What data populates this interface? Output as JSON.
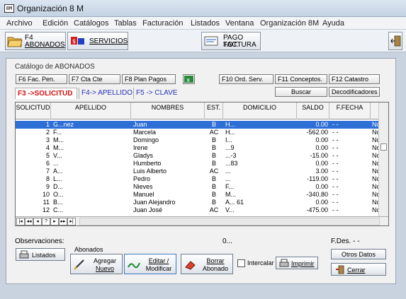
{
  "window": {
    "icon_text": "8M",
    "title": "Organización  8 M"
  },
  "menu": [
    "Archivo",
    "Edición",
    "Catálogos",
    "Tablas",
    "Facturación",
    "Listados",
    "Ventana",
    "Organización 8M",
    "Ayuda"
  ],
  "toolbar": {
    "abonados_line1": "F4",
    "abonados_line2": "ABONADOS",
    "servicios": "SERVICIOS",
    "pago_line1": "PAGO TOT.",
    "pago_line2": "FACTURA"
  },
  "catalog": {
    "title": "Catálogo de ABONADOS",
    "fkeys_left": [
      "F6   Fac. Pen.",
      "F7        Cta Cte",
      "F8  Plan  Pagos"
    ],
    "fkeys_right": [
      "F10   Ord. Serv.",
      "F11  Conceptos.",
      "F12        Catastro"
    ],
    "buscar": "Buscar",
    "decodificadores": "Decodificadores"
  },
  "tabs": [
    "F3 ->SOLICITUD",
    "F4-> APELLIDO",
    "F5 -> CLAVE"
  ],
  "grid": {
    "columns": [
      "SOLICITUD",
      "APELLIDO",
      "NOMBRES",
      "EST.",
      "DOMICILIO",
      "SALDO",
      "F.FECHA",
      ""
    ],
    "rows": [
      {
        "sol": "1",
        "ape": "G...nez",
        "nom": "Juan",
        "est": "B",
        "dom": "H...",
        "saldo": "0.00",
        "fecha": "-   -",
        "x": "No"
      },
      {
        "sol": "2",
        "ape": "F...",
        "nom": "Marcela",
        "est": "AC",
        "dom": "H...",
        "saldo": "-562.00",
        "fecha": "-   -",
        "x": "No"
      },
      {
        "sol": "3",
        "ape": "M...",
        "nom": "Domingo",
        "est": "B",
        "dom": "I...",
        "saldo": "0.00",
        "fecha": "-   -",
        "x": "No"
      },
      {
        "sol": "4",
        "ape": "M...",
        "nom": "Irene",
        "est": "B",
        "dom": "...9",
        "saldo": "0.00",
        "fecha": "-   -",
        "x": "No"
      },
      {
        "sol": "5",
        "ape": "V...",
        "nom": "Gladys",
        "est": "B",
        "dom": "...-3",
        "saldo": "-15.00",
        "fecha": "-   -",
        "x": "No"
      },
      {
        "sol": "6",
        "ape": "...",
        "nom": "Humberto",
        "est": "B",
        "dom": "...83",
        "saldo": "0.00",
        "fecha": "-   -",
        "x": "No"
      },
      {
        "sol": "7",
        "ape": "A...",
        "nom": "Luis Alberto",
        "est": "AC",
        "dom": "...",
        "saldo": "3.00",
        "fecha": "-   -",
        "x": "No"
      },
      {
        "sol": "8",
        "ape": "L...",
        "nom": "Pedro",
        "est": "B",
        "dom": "...",
        "saldo": "-119.00",
        "fecha": "-   -",
        "x": "No"
      },
      {
        "sol": "9",
        "ape": "D...",
        "nom": "Nieves",
        "est": "B",
        "dom": "F...",
        "saldo": "0.00",
        "fecha": "-   -",
        "x": "No"
      },
      {
        "sol": "10",
        "ape": "O...",
        "nom": "Manuel",
        "est": "B",
        "dom": "M...",
        "saldo": "-340.80",
        "fecha": "-   -",
        "x": "No"
      },
      {
        "sol": "11",
        "ape": "B...",
        "nom": "Juan Alejandro",
        "est": "B",
        "dom": "A... 61",
        "saldo": "0.00",
        "fecha": "-   -",
        "x": "No"
      },
      {
        "sol": "12",
        "ape": "C...",
        "nom": "Juan José",
        "est": "AC",
        "dom": "V...",
        "saldo": "-475.00",
        "fecha": "-   -",
        "x": "No"
      }
    ],
    "selected_row": 0
  },
  "nav": [
    "|◂",
    "◂◂",
    "◂",
    "?",
    "▸",
    "▸▸",
    "▸|"
  ],
  "footer": {
    "observaciones": "Observaciones:",
    "obs_value": "0...",
    "fdes": "F.Des.   -  -",
    "abonados_group": "Abonados",
    "listados": "Listados",
    "agregar_line1": "Agregar",
    "agregar_line2": "Nuevo",
    "editar_line1": "Editar /",
    "editar_line2": "Modificar",
    "borrar_line1": "Borrar",
    "borrar_line2": "Abonado",
    "intercalar": "Intercalar",
    "imprimir": "Imprimir",
    "otros_datos": "Otros Datos",
    "cerrar": "Cerrar"
  }
}
